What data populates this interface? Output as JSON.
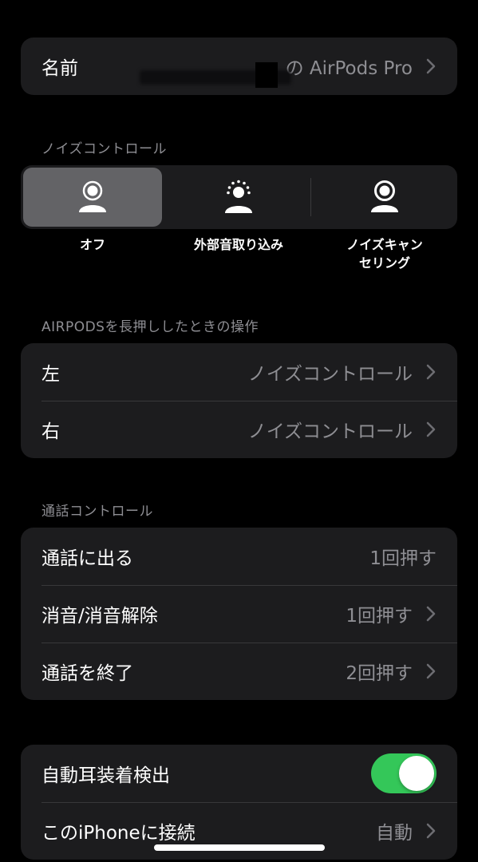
{
  "name_row": {
    "label": "名前",
    "value": "の AirPods Pro"
  },
  "noise_control": {
    "header": "ノイズコントロール",
    "options": [
      {
        "label": "オフ",
        "icon": "person-off-icon",
        "selected": true
      },
      {
        "label": "外部音取り込み",
        "icon": "person-transparency-icon",
        "selected": false
      },
      {
        "label_line1": "ノイズキャン",
        "label_line2": "セリング",
        "icon": "person-noise-cancel-icon",
        "selected": false
      }
    ]
  },
  "press_hold": {
    "header": "AIRPODSを長押ししたときの操作",
    "rows": [
      {
        "label": "左",
        "value": "ノイズコントロール"
      },
      {
        "label": "右",
        "value": "ノイズコントロール"
      }
    ]
  },
  "call_controls": {
    "header": "通話コントロール",
    "rows": [
      {
        "label": "通話に出る",
        "value": "1回押す"
      },
      {
        "label": "消音/消音解除",
        "value": "1回押す"
      },
      {
        "label": "通話を終了",
        "value": "2回押す"
      }
    ]
  },
  "settings": {
    "rows": [
      {
        "label": "自動耳装着検出",
        "toggle_on": true
      },
      {
        "label": "このiPhoneに接続",
        "value": "自動"
      }
    ]
  },
  "colors": {
    "accent_toggle": "#34c759",
    "cell_bg": "#1c1c1e",
    "secondary_text": "#8e8e93"
  }
}
